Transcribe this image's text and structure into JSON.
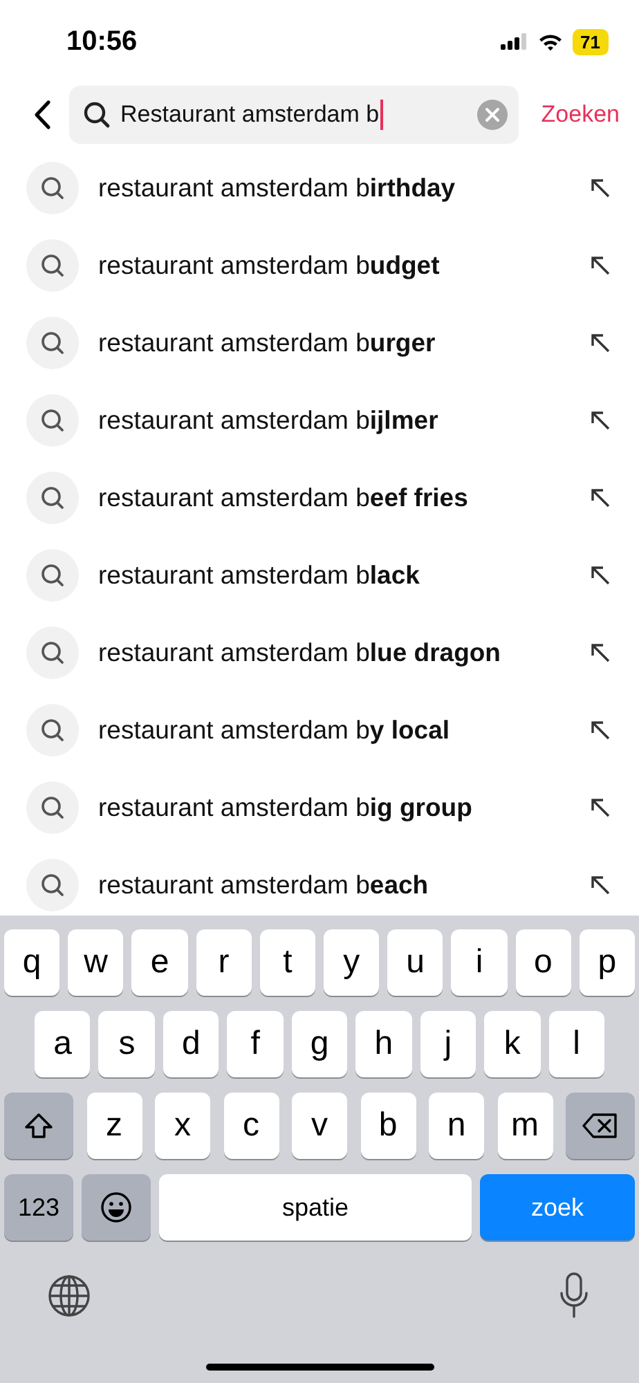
{
  "status_bar": {
    "time": "10:56",
    "battery": "71"
  },
  "search": {
    "value": "Restaurant amsterdam b",
    "action": "Zoeken"
  },
  "suggestions": [
    {
      "text": "restaurant amsterdam b**irthday**"
    },
    {
      "text": "restaurant amsterdam b**udget**"
    },
    {
      "text": "restaurant amsterdam b**urger**"
    },
    {
      "text": "restaurant amsterdam b**ijlmer**"
    },
    {
      "text": "restaurant amsterdam b**eef fries**"
    },
    {
      "text": "restaurant amsterdam b**lack**"
    },
    {
      "text": "restaurant amsterdam b**lue dragon**"
    },
    {
      "text": "restaurant amsterdam b**y local**"
    },
    {
      "text": "restaurant amsterdam b**ig group**"
    },
    {
      "text": "restaurant amsterdam b**each**"
    }
  ],
  "keyboard": {
    "rows": [
      [
        "q",
        "w",
        "e",
        "r",
        "t",
        "y",
        "u",
        "i",
        "o",
        "p"
      ],
      [
        "a",
        "s",
        "d",
        "f",
        "g",
        "h",
        "j",
        "k",
        "l"
      ],
      [
        "z",
        "x",
        "c",
        "v",
        "b",
        "n",
        "m"
      ]
    ],
    "numbers_key": "123",
    "space_key": "spatie",
    "return_key": "zoek"
  }
}
